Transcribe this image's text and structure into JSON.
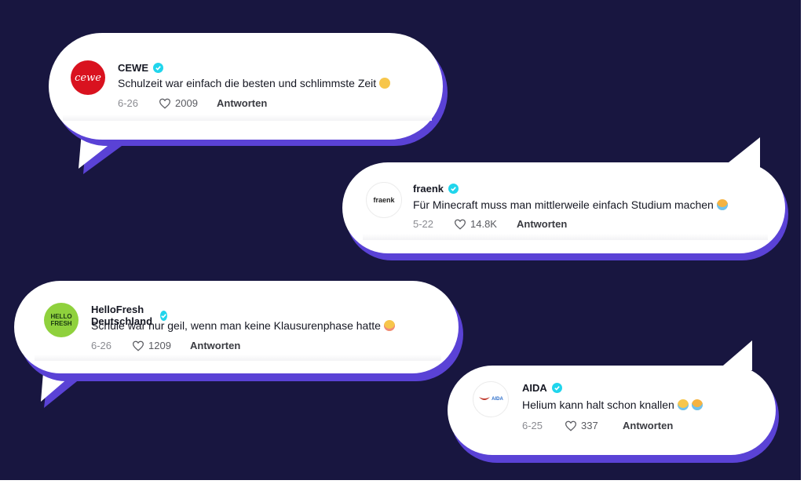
{
  "comments": [
    {
      "name": "CEWE",
      "avatar_text": "cewe",
      "text": "Schulzeit war einfach die besten und schlimmste Zeit",
      "emojis": [
        "nerd-face-emoji"
      ],
      "date": "6-26",
      "likes": "2009",
      "reply": "Antworten"
    },
    {
      "name": "fraenk",
      "avatar_text": "fraenk",
      "text": "Für Minecraft muss man mittlerweile einfach Studium machen",
      "emojis": [
        "loudly-crying-face-emoji"
      ],
      "date": "5-22",
      "likes": "14.8K",
      "reply": "Antworten"
    },
    {
      "name": "HelloFresh Deutschland",
      "avatar_text": "HELLO FRESH",
      "text": "Schule war nur geil, wenn man keine Klausurenphase hatte",
      "emojis": [
        "flushed-face-emoji"
      ],
      "date": "6-26",
      "likes": "1209",
      "reply": "Antworten"
    },
    {
      "name": "AIDA",
      "avatar_text": "AIDA",
      "text": "Helium kann halt schon knallen",
      "emojis": [
        "laughing-tears-emoji",
        "loudly-crying-face-emoji"
      ],
      "date": "6-25",
      "likes": "337",
      "reply": "Antworten"
    }
  ],
  "colors": {
    "background": "#181640",
    "bubble_shadow": "#5a42d6",
    "verified": "#20d5ec",
    "cewe_red": "#d9121f",
    "hellofresh_green": "#8fd13d"
  }
}
